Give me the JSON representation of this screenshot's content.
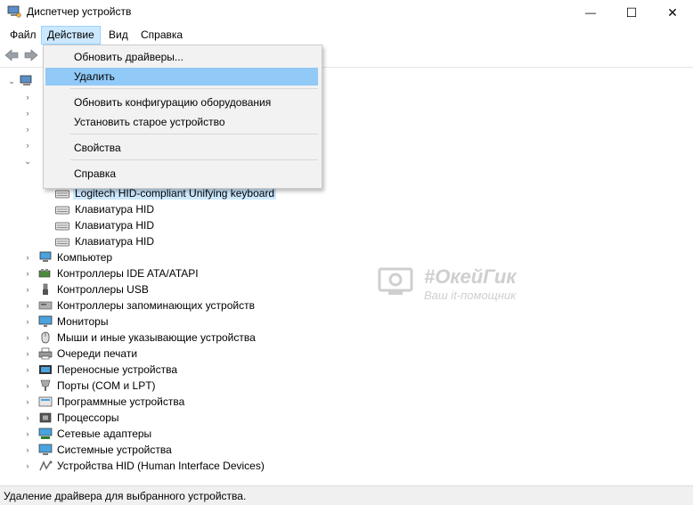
{
  "window": {
    "title": "Диспетчер устройств",
    "minimize_glyph": "—",
    "maximize_glyph": "☐",
    "close_glyph": "✕"
  },
  "menubar": {
    "items": [
      "Файл",
      "Действие",
      "Вид",
      "Справка"
    ],
    "active": "Действие"
  },
  "dropdown": {
    "items": [
      {
        "label": "Обновить драйверы..."
      },
      {
        "label": "Удалить",
        "highlighted": true
      },
      {
        "label": "Обновить конфигурацию оборудования"
      },
      {
        "label": "Установить старое устройство"
      },
      {
        "label": "Свойства"
      },
      {
        "label": "Справка"
      }
    ]
  },
  "tree": {
    "keyboard_children": [
      "Logitech HID-compliant Unifying keyboard",
      "Клавиатура HID",
      "Клавиатура HID",
      "Клавиатура HID"
    ],
    "categories": [
      {
        "label": "Компьютер",
        "icon": "computer-icon"
      },
      {
        "label": "Контроллеры IDE ATA/ATAPI",
        "icon": "ide-controller-icon"
      },
      {
        "label": "Контроллеры USB",
        "icon": "usb-icon"
      },
      {
        "label": "Контроллеры запоминающих устройств",
        "icon": "storage-controller-icon"
      },
      {
        "label": "Мониторы",
        "icon": "monitor-icon"
      },
      {
        "label": "Мыши и иные указывающие устройства",
        "icon": "mouse-icon"
      },
      {
        "label": "Очереди печати",
        "icon": "printer-icon"
      },
      {
        "label": "Переносные устройства",
        "icon": "portable-device-icon"
      },
      {
        "label": "Порты (COM и LPT)",
        "icon": "port-icon"
      },
      {
        "label": "Программные устройства",
        "icon": "software-device-icon"
      },
      {
        "label": "Процессоры",
        "icon": "processor-icon"
      },
      {
        "label": "Сетевые адаптеры",
        "icon": "network-adapter-icon"
      },
      {
        "label": "Системные устройства",
        "icon": "system-device-icon"
      },
      {
        "label": "Устройства HID (Human Interface Devices)",
        "icon": "hid-icon"
      }
    ]
  },
  "watermark": {
    "title": "#ОкейГик",
    "subtitle": "Ваш it-помощник"
  },
  "statusbar": {
    "text": "Удаление драйвера для выбранного устройства."
  }
}
